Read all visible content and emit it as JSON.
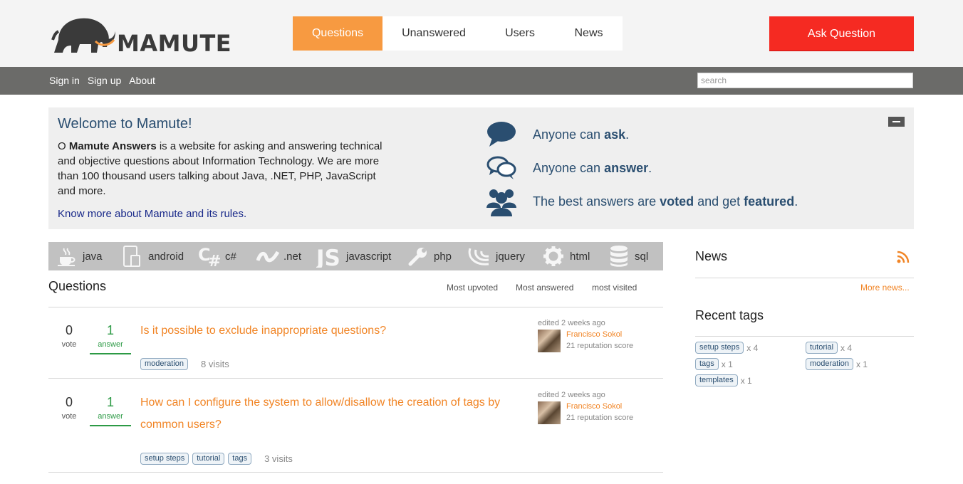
{
  "logo": {
    "text": "MAMUTE"
  },
  "nav": {
    "items": [
      "Questions",
      "Unanswered",
      "Users",
      "News"
    ],
    "active": "Questions"
  },
  "ask_button": "Ask Question",
  "topbar": {
    "links": [
      "Sign in",
      "Sign up",
      "About"
    ],
    "search_placeholder": "search"
  },
  "welcome": {
    "title": "Welcome to Mamute!",
    "desc_prefix": "O ",
    "desc_bold": "Mamute Answers",
    "desc_rest": " is a website for asking and answering technical and objective questions about Information Technology. We are more than 100 thousand users talking about Java, .NET, PHP, JavaScript and more.",
    "more_link": "Know more about Mamute and its rules.",
    "features": [
      {
        "icon": "speech-bubble-icon",
        "before": "Anyone can ",
        "bold": "ask",
        "after": "."
      },
      {
        "icon": "chat-bubbles-icon",
        "before": "Anyone can ",
        "bold": "answer",
        "after": "."
      },
      {
        "icon": "users-icon",
        "before": "The best answers are ",
        "bold": "voted",
        "middle": " and get ",
        "bold2": "featured",
        "after": "."
      }
    ]
  },
  "tagbar": [
    {
      "label": "java",
      "icon": "coffee-cup-icon"
    },
    {
      "label": "android",
      "icon": "phone-icon"
    },
    {
      "label": "c#",
      "icon": "csharp-icon"
    },
    {
      "label": ".net",
      "icon": "dotnet-icon"
    },
    {
      "label": "javascript",
      "icon": "js-icon"
    },
    {
      "label": "php",
      "icon": "wrench-icon"
    },
    {
      "label": "jquery",
      "icon": "jquery-icon"
    },
    {
      "label": "html",
      "icon": "gear-icon"
    },
    {
      "label": "sql",
      "icon": "database-icon"
    }
  ],
  "questions": {
    "title": "Questions",
    "sort": [
      "Most upvoted",
      "Most answered",
      "most visited"
    ],
    "items": [
      {
        "votes": "0",
        "vote_label": "vote",
        "answers": "1",
        "answer_label": "answer",
        "title": "Is it possible to exclude inappropriate questions?",
        "tags": [
          "moderation"
        ],
        "visits": "8 visits",
        "edited": "edited 2 weeks ago",
        "user": "Francisco Sokol",
        "reputation": "21 reputation score"
      },
      {
        "votes": "0",
        "vote_label": "vote",
        "answers": "1",
        "answer_label": "answer",
        "title": "How can I configure the system to allow/disallow the creation of tags by common users?",
        "tags": [
          "setup steps",
          "tutorial",
          "tags"
        ],
        "visits": "3 visits",
        "edited": "edited 2 weeks ago",
        "user": "Francisco Sokol",
        "reputation": "21 reputation score"
      }
    ]
  },
  "sidebar": {
    "news_title": "News",
    "more_news": "More news...",
    "recent_tags_title": "Recent tags",
    "recent_tags": [
      {
        "name": "setup steps",
        "count": "x 4"
      },
      {
        "name": "tutorial",
        "count": "x 4"
      },
      {
        "name": "tags",
        "count": "x 1"
      },
      {
        "name": "moderation",
        "count": "x 1"
      },
      {
        "name": "templates",
        "count": "x 1"
      }
    ]
  },
  "colors": {
    "accent": "#f79a41",
    "ask": "#f52a22",
    "bar": "#6b6b69",
    "link": "#f18526",
    "title_blue": "#2a4e70"
  }
}
